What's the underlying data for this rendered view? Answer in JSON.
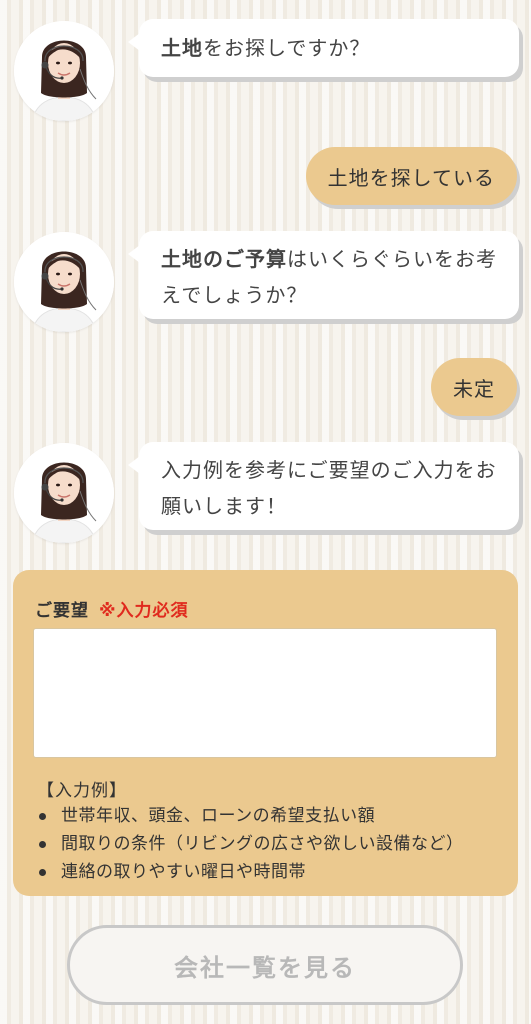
{
  "chat": {
    "q1": {
      "bold": "土地",
      "rest": "をお探しですか？"
    },
    "a1": "土地を探している",
    "q2": {
      "bold": "土地のご予算",
      "rest": "はいくらぐらいをお考えでしょうか？"
    },
    "a2": "未定",
    "q3": {
      "text": "入力例を参考にご要望のご入力をお願いします！"
    }
  },
  "form": {
    "label": "ご要望",
    "required": "※入力必須",
    "textarea_value": "",
    "example_title": "【入力例】",
    "examples": [
      "世帯年収、頭金、ローンの希望支払い額",
      "間取りの条件（リビングの広さや欲しい設備など）",
      "連絡の取りやすい曜日や時間帯"
    ]
  },
  "submit_label": "会社一覧を見る",
  "colors": {
    "user_bubble": "#ebc98f",
    "form_panel": "#ebc98f",
    "required_text": "#e02a1e",
    "button_text_disabled": "#b8b8b8"
  },
  "icons": {
    "operator": "operator-avatar-icon"
  }
}
